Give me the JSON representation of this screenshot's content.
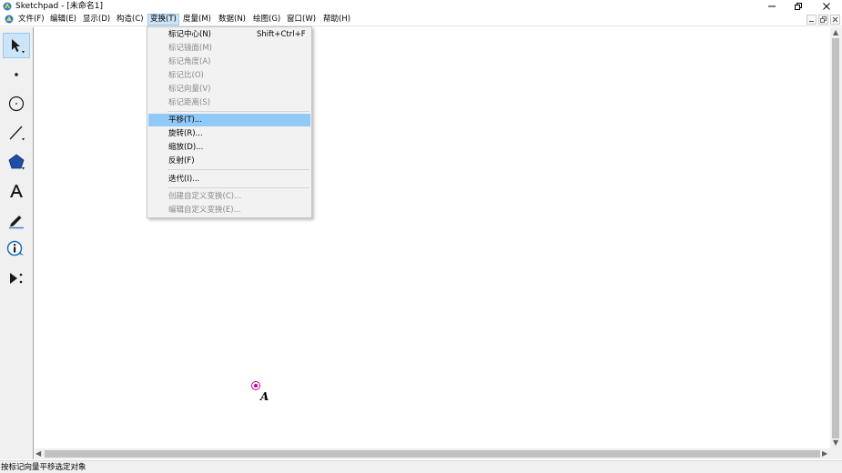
{
  "window": {
    "title": "Sketchpad - [未命名1]"
  },
  "menubar": {
    "items": [
      "文件(F)",
      "编辑(E)",
      "显示(D)",
      "构造(C)",
      "变换(T)",
      "度量(M)",
      "数据(N)",
      "绘图(G)",
      "窗口(W)",
      "帮助(H)"
    ],
    "active": "变换(T)"
  },
  "dropdown": {
    "items": [
      {
        "label": "标记中心(N)",
        "shortcut": "Shift+Ctrl+F",
        "enabled": true
      },
      {
        "label": "标记镜面(M)",
        "enabled": false
      },
      {
        "label": "标记角度(A)",
        "enabled": false
      },
      {
        "label": "标记比(O)",
        "enabled": false
      },
      {
        "label": "标记向量(V)",
        "enabled": false
      },
      {
        "label": "标记距离(S)",
        "enabled": false
      },
      {
        "label": "平移(T)...",
        "enabled": true,
        "highlighted": true
      },
      {
        "label": "旋转(R)...",
        "enabled": true
      },
      {
        "label": "缩放(D)...",
        "enabled": true
      },
      {
        "label": "反射(F)",
        "enabled": true
      },
      {
        "label": "迭代(I)...",
        "enabled": true
      },
      {
        "label": "创建自定义变换(C)...",
        "enabled": false
      },
      {
        "label": "编辑自定义变换(E)...",
        "enabled": false
      }
    ]
  },
  "toolbox": {
    "tools": [
      "selection-arrow-tool",
      "point-tool",
      "compass-tool",
      "straightedge-tool",
      "polygon-tool",
      "text-tool",
      "marker-tool",
      "information-tool",
      "custom-tool"
    ],
    "selected": "selection-arrow-tool"
  },
  "canvas": {
    "point_label": "A",
    "point_color": "#c2008f"
  },
  "statusbar": {
    "text": "按标记向量平移选定对象"
  },
  "colors": {
    "menu_highlight": "#91c9f7",
    "menu_active": "#cce4f7"
  }
}
